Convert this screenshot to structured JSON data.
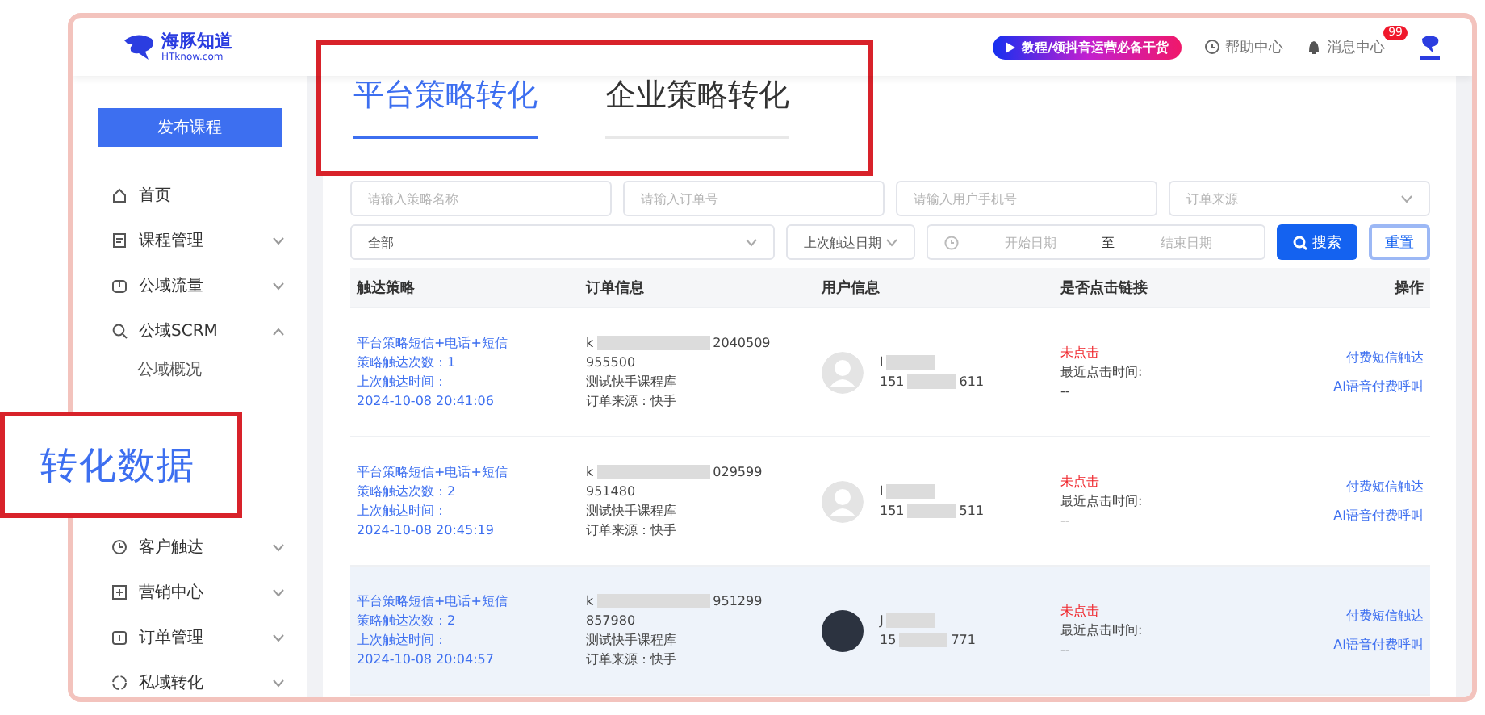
{
  "header": {
    "logo_title": "海豚知道",
    "logo_subtitle": "HTknow.com",
    "promo": "教程/领抖音运营必备干货",
    "help": "帮助中心",
    "messages": "消息中心",
    "message_badge": "99"
  },
  "sidebar": {
    "publish_button": "发布课程",
    "items": [
      {
        "label": "首页"
      },
      {
        "label": "课程管理",
        "expanded": false
      },
      {
        "label": "公域流量",
        "expanded": false
      },
      {
        "label": "公域SCRM",
        "expanded": true,
        "children": [
          {
            "label": "公域概况"
          }
        ]
      },
      {
        "label": "客户触达",
        "expanded": false
      },
      {
        "label": "营销中心",
        "expanded": false
      },
      {
        "label": "订单管理",
        "expanded": false
      },
      {
        "label": "私域转化",
        "expanded": false
      }
    ]
  },
  "callout": "转化数据",
  "tabs": [
    {
      "label": "平台策略转化",
      "selected": true
    },
    {
      "label": "企业策略转化",
      "selected": false
    }
  ],
  "filters": [
    {
      "kind": "input",
      "placeholder": "请输入策略名称"
    },
    {
      "kind": "input",
      "placeholder": "请输入订单号"
    },
    {
      "kind": "input",
      "placeholder": "请输入用户手机号"
    },
    {
      "kind": "select",
      "placeholder": "订单来源"
    },
    {
      "kind": "select",
      "value": "全部"
    },
    {
      "kind": "select",
      "value": "上次触达日期"
    },
    {
      "kind": "daterange",
      "start": "开始日期",
      "separator": "至",
      "end": "结束日期"
    }
  ],
  "search_button": "搜索",
  "reset_button": "重置",
  "table": {
    "columns": [
      "触达策略",
      "订单信息",
      "用户信息",
      "是否点击链接",
      "操作"
    ],
    "rows": [
      {
        "highlighted": false,
        "strategy": [
          "平台策略短信+电话+短信",
          "策略触达次数：1",
          "上次触达时间：",
          "2024-10-08 20:41:06"
        ],
        "order": {
          "id_prefix": "k",
          "id_suffix": "2040509",
          "number": "955500",
          "product": "测试快手课程库",
          "source": "订单来源：快手"
        },
        "user": {
          "photo": false,
          "name_prefix": "l",
          "phone_prefix": "151",
          "phone_suffix": "611"
        },
        "click": {
          "status": "未点击",
          "time_label": "最近点击时间:",
          "time": "--"
        },
        "actions": [
          "付费短信触达",
          "AI语音付费呼叫"
        ]
      },
      {
        "highlighted": false,
        "strategy": [
          "平台策略短信+电话+短信",
          "策略触达次数：2",
          "上次触达时间：",
          "2024-10-08 20:45:19"
        ],
        "order": {
          "id_prefix": "k",
          "id_suffix": "029599",
          "number": "951480",
          "product": "测试快手课程库",
          "source": "订单来源：快手"
        },
        "user": {
          "photo": false,
          "name_prefix": "l",
          "phone_prefix": "151",
          "phone_suffix": "511"
        },
        "click": {
          "status": "未点击",
          "time_label": "最近点击时间:",
          "time": "--"
        },
        "actions": [
          "付费短信触达",
          "AI语音付费呼叫"
        ]
      },
      {
        "highlighted": true,
        "strategy": [
          "平台策略短信+电话+短信",
          "策略触达次数：2",
          "上次触达时间：",
          "2024-10-08 20:04:57"
        ],
        "order": {
          "id_prefix": "k",
          "id_suffix": "951299",
          "number": "857980",
          "product": "测试快手课程库",
          "source": "订单来源：快手"
        },
        "user": {
          "photo": true,
          "name_prefix": "J",
          "phone_prefix": "15",
          "phone_suffix": "771"
        },
        "click": {
          "status": "未点击",
          "time_label": "最近点击时间:",
          "time": "--"
        },
        "actions": [
          "付费短信触达",
          "AI语音付费呼叫"
        ]
      }
    ]
  }
}
